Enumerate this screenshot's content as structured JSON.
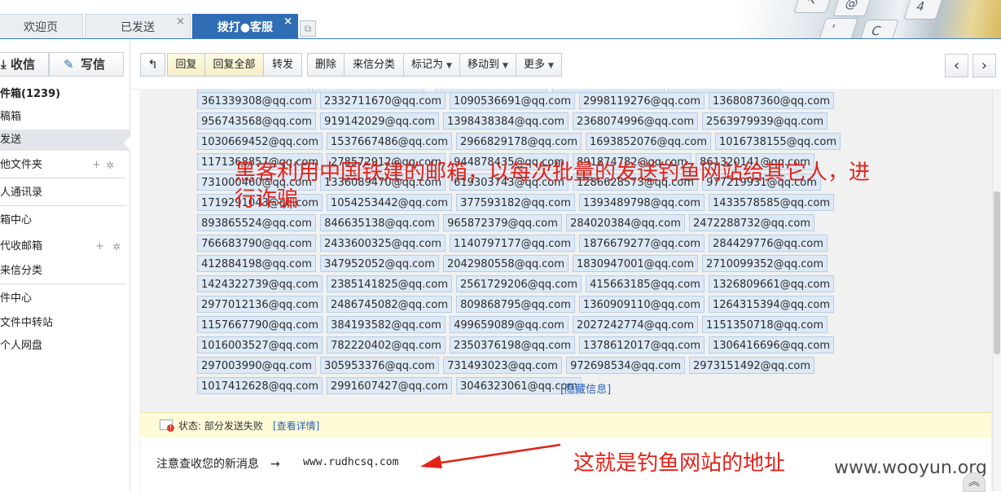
{
  "tabs": [
    {
      "label": "欢迎页",
      "closable": false,
      "active": false
    },
    {
      "label": "已发送",
      "closable": true,
      "active": false
    },
    {
      "label": "拨打●客服",
      "closable": true,
      "active": true
    }
  ],
  "tab_close_glyph": "×",
  "header_keys": [
    "↖",
    "@",
    "'",
    "C",
    "4"
  ],
  "sidebar": {
    "receive_label": "收信",
    "compose_label": "写信",
    "items": [
      {
        "label": "件箱(1239)",
        "bold": true
      },
      {
        "label": "稿箱"
      },
      {
        "label": "发送",
        "selected": true
      },
      {
        "label": "他文件夹",
        "actions": true
      },
      {
        "label": "人通讯录"
      },
      {
        "label": "箱中心"
      },
      {
        "label": "代收邮箱",
        "actions": true
      },
      {
        "label": "来信分类"
      },
      {
        "label": "件中心"
      },
      {
        "label": "文件中转站"
      },
      {
        "label": "个人网盘"
      }
    ]
  },
  "toolbar": {
    "back_icon": "↰",
    "reply": "回复",
    "reply_all": "回复全部",
    "forward": "转发",
    "delete": "删除",
    "sort_by_sender": "来信分类",
    "mark_as": "标记为",
    "move_to": "移动到",
    "more": "更多",
    "prev": "‹",
    "next": "›"
  },
  "recipients": [
    [
      "361339308@qq.com",
      "2332711670@qq.com",
      "1090536691@qq.com",
      "2998119276@qq.com",
      "1368087360@qq.com"
    ],
    [
      "956743568@qq.com",
      "919142029@qq.com",
      "1398438384@qq.com",
      "2368074996@qq.com",
      "2563979939@qq.com"
    ],
    [
      "1030669452@qq.com",
      "1537667486@qq.com",
      "2966829178@qq.com",
      "1693852076@qq.com",
      "1016738155@qq.com"
    ],
    [
      "1171368857@qq.com",
      "278572912@qq.com",
      "944878435@qq.com",
      "891874782@qq.com",
      "861320141@qq.com"
    ],
    [
      "731000460@qq.com",
      "1336089470@qq.com",
      "619303743@qq.com",
      "1286628573@qq.com",
      "977219931@qq.com"
    ],
    [
      "1719291043@qq.com",
      "1054253442@qq.com",
      "377593182@qq.com",
      "1393489798@qq.com",
      "1433578585@qq.com"
    ],
    [
      "893865524@qq.com",
      "846635138@qq.com",
      "965872379@qq.com",
      "284020384@qq.com",
      "2472288732@qq.com"
    ],
    [
      "766683790@qq.com",
      "2433600325@qq.com",
      "1140797177@qq.com",
      "1876679277@qq.com",
      "284429776@qq.com"
    ],
    [
      "412884198@qq.com",
      "347952052@qq.com",
      "2042980558@qq.com",
      "1830947001@qq.com",
      "2710099352@qq.com"
    ],
    [
      "1424322739@qq.com",
      "2385141825@qq.com",
      "2561729206@qq.com",
      "415663185@qq.com",
      "1326809661@qq.com"
    ],
    [
      "2977012136@qq.com",
      "2486745082@qq.com",
      "809868795@qq.com",
      "1360909110@qq.com",
      "1264315394@qq.com"
    ],
    [
      "1157667790@qq.com",
      "384193582@qq.com",
      "499659089@qq.com",
      "2027242774@qq.com",
      "1151350718@qq.com"
    ],
    [
      "1016003527@qq.com",
      "782220402@qq.com",
      "2350376198@qq.com",
      "1378612017@qq.com",
      "1306416696@qq.com"
    ],
    [
      "297003990@qq.com",
      "305953376@qq.com",
      "731493023@qq.com",
      "972698534@qq.com",
      "2973151492@qq.com"
    ],
    [
      "1017412628@qq.com",
      "2991607427@qq.com",
      "3046323061@qq.com"
    ]
  ],
  "hide_info": "[隐藏信息]",
  "status": {
    "text": "状态: 部分发送失败",
    "link": "[查看详情]"
  },
  "message": {
    "notice": "注意查收您的新消息　→",
    "url": "www.rudhcsq.com"
  },
  "annotations": {
    "top": "黑客利用中国铁建的邮箱，以每次批量的发送钓鱼网站给其它人，进行诈骗",
    "bottom": "这就是钓鱼网站的地址",
    "color": "#e2231a"
  },
  "watermark": "www.wooyun.org",
  "colors": {
    "tab_active": "#2f6db5",
    "addr_bg": "#dde9f6",
    "status_bg": "#fffbd8",
    "link": "#2a62b8"
  }
}
